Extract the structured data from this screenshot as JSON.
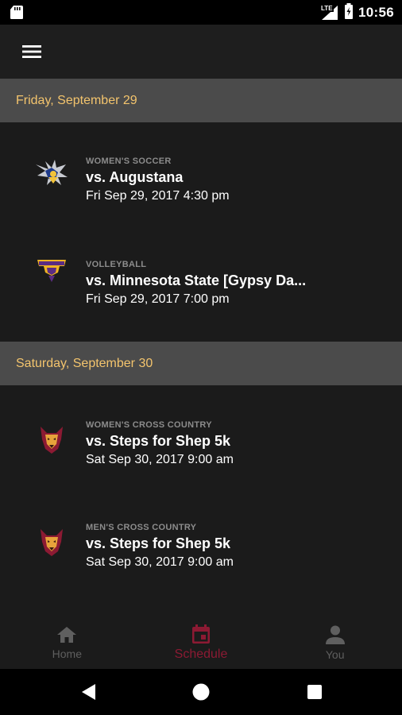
{
  "status_bar": {
    "time": "10:56",
    "network": "LTE"
  },
  "nav": {
    "items": [
      {
        "label": "Home",
        "icon": "home-icon",
        "active": false
      },
      {
        "label": "Schedule",
        "icon": "calendar-icon",
        "active": true
      },
      {
        "label": "You",
        "icon": "person-icon",
        "active": false
      }
    ]
  },
  "colors": {
    "date_header_text": "#f3c46d",
    "accent": "#8c1a33",
    "date_header_bg": "#4b4b4b"
  },
  "schedule": [
    {
      "date": "Friday, September 29",
      "events": [
        {
          "sport": "WOMEN'S SOCCER",
          "title": "vs. Augustana",
          "time": "Fri Sep 29, 2017 4:30 pm",
          "logo": "augustana-viking-logo"
        },
        {
          "sport": "VOLLEYBALL",
          "title": "vs. Minnesota State [Gypsy Da...",
          "time": "Fri Sep 29, 2017 7:00 pm",
          "logo": "minnesota-state-logo"
        }
      ]
    },
    {
      "date": "Saturday, September 30",
      "events": [
        {
          "sport": "WOMEN'S CROSS COUNTRY",
          "title": "vs. Steps for Shep 5k",
          "time": "Sat Sep 30, 2017 9:00 am",
          "logo": "wolf-logo"
        },
        {
          "sport": "MEN'S CROSS COUNTRY",
          "title": "vs. Steps for Shep 5k",
          "time": "Sat Sep 30, 2017 9:00 am",
          "logo": "wolf-logo"
        }
      ]
    }
  ]
}
